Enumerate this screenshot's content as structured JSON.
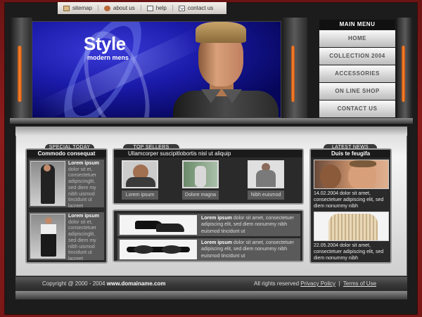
{
  "toplinks": [
    {
      "label": "sitemap",
      "icon": "sitemap-icon"
    },
    {
      "label": "about us",
      "icon": "about-icon"
    },
    {
      "label": "help",
      "icon": "help-icon"
    },
    {
      "label": "contact us",
      "icon": "mail-icon"
    }
  ],
  "hero": {
    "title": "Style",
    "subtitle": "modern mens"
  },
  "menu": {
    "title": "MAIN MENU",
    "items": [
      "HOME",
      "COLLECTION 2004",
      "ACCESSORIES",
      "ON LINE SHOP",
      "CONTACT US"
    ]
  },
  "special": {
    "tab": "SPECIAL TODAY",
    "heading": "Commodo consequat",
    "items": [
      {
        "title": "Lorem ipsum",
        "text": "dolor sit et, consectetuer adipiscinglit, sed diem my nibh uismod tincidunt ut lacreet"
      },
      {
        "title": "Lorem ipsum",
        "text": "dolor sit et, consectetuer adipiscinglit, sed diem my nibh uismod tincidunt ut lacreet"
      }
    ]
  },
  "sellers": {
    "tab": "TOP SELLERS",
    "subtitle": "Ullamcorper suscipitlobortis nisl ut aliquip",
    "items": [
      "Lorem ipsum",
      "Dolore magna",
      "Nibh euismod"
    ]
  },
  "products": [
    {
      "title": "Lorem ipsum",
      "text": "dolor sit amet, consectetuer adipiscing elit, sed diem nonummy nibh euismod tincidunt ut"
    },
    {
      "title": "Lorem ipsum",
      "text": "dolor sit amet, consectetuer adipiscing elit, sed diem nonummy nibh euismod tincidunt ut"
    }
  ],
  "news": {
    "tab": "LATEST NEWS",
    "heading": "Duis te feugifa",
    "items": [
      {
        "text": "14.02.2004 dolor sit amet, consectetuer adipiscing elit, sed diem nonummy nibh"
      },
      {
        "text": "22.05.2004 dolor sit amet, consectetuer adipiscing elit, sed diem nonummy nibh"
      }
    ]
  },
  "footer": {
    "copyright": "Copyright @ 2000 - 2004",
    "domain": "www.domainame.com",
    "rights": "All rights reserved",
    "privacy": "Privacy Policy",
    "separator": "|",
    "terms": "Terms of Use"
  }
}
